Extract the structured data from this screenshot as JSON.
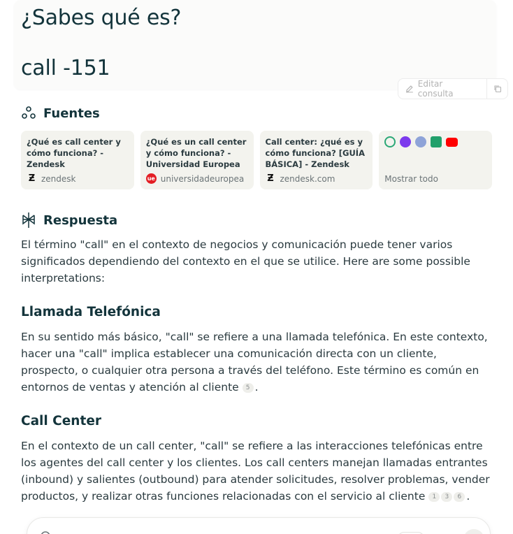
{
  "query": {
    "title": "¿Sabes qué es?",
    "subtitle": "call -151",
    "edit_label": "Editar consulta"
  },
  "sources": {
    "heading": "Fuentes",
    "items": [
      {
        "title": "¿Qué es call center y cómo funciona? - Zendesk",
        "site": "zendesk"
      },
      {
        "title": "¿Qué es un call center y cómo funciona? - Universidad Europea",
        "site": "universidadeuropea"
      },
      {
        "title": "Call center: ¿qué es y cómo funciona? [GUÍA BÁSICA] - Zendesk",
        "site": "zendesk.com"
      }
    ],
    "show_all": "Mostrar todo"
  },
  "answer": {
    "heading": "Respuesta",
    "intro": "El término \"call\" en el contexto de negocios y comunicación puede tener varios significados dependiendo del contexto en el que se utilice. Here are some possible interpretations:",
    "sections": [
      {
        "title": "Llamada Telefónica",
        "text": "En su sentido más básico, \"call\" se refiere a una llamada telefónica. En este contexto, hacer una \"call\" implica establecer una comunicación directa con un cliente, prospecto, o cualquier otra persona a través del teléfono. Este término es común en entornos de ventas y atención al cliente",
        "citations": [
          "5"
        ]
      },
      {
        "title": "Call Center",
        "text": "En el contexto de un call center, \"call\" se refiere a las interacciones telefónicas entre los agentes del call center y los clientes. Los call centers manejan llamadas entrantes (inbound) y salientes (outbound) para atender solicitudes, resolver problemas, vender productos, y realizar otras funciones relacionadas con el servicio al cliente",
        "citations": [
          "1",
          "3",
          "6"
        ]
      }
    ]
  }
}
